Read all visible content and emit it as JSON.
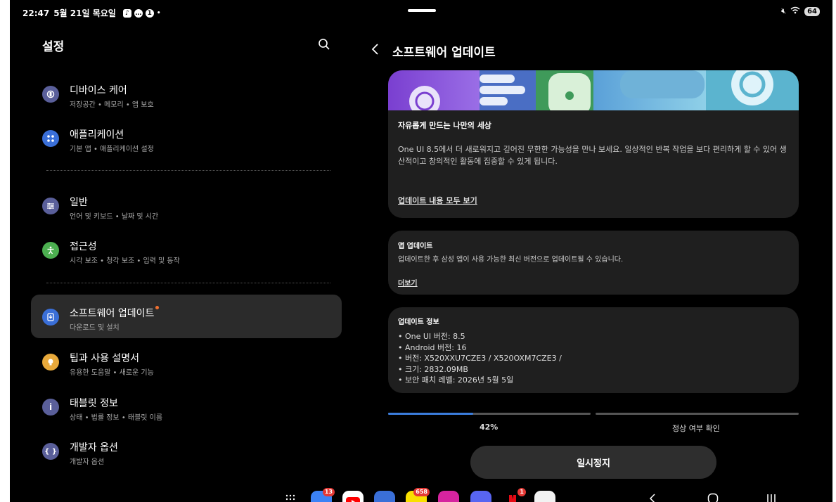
{
  "status_bar": {
    "time": "22:47",
    "date": "5월 21일 목요일",
    "notif_count": "1",
    "battery": "64"
  },
  "left": {
    "title": "설정",
    "items": [
      {
        "title": "디바이스 케어",
        "sub": "저장공간 • 메모리 • 앱 보호",
        "icon": "device-care-icon",
        "color": "#5a5f9a"
      },
      {
        "title": "애플리케이션",
        "sub": "기본 앱 • 애플리케이션 설정",
        "icon": "apps-icon",
        "color": "#3a6fd8"
      },
      {
        "title": "일반",
        "sub": "언어 및 키보드 • 날짜 및 시간",
        "icon": "general-icon",
        "color": "#5a5f9a"
      },
      {
        "title": "접근성",
        "sub": "시각 보조 • 청각 보조 • 입력 및 동작",
        "icon": "accessibility-icon",
        "color": "#4caf50"
      },
      {
        "title": "소프트웨어 업데이트",
        "sub": "다운로드 및 설치",
        "icon": "software-update-icon",
        "color": "#3a6fd8"
      },
      {
        "title": "팁과 사용 설명서",
        "sub": "유용한 도움말 • 새로운 기능",
        "icon": "tips-icon",
        "color": "#e8a93b"
      },
      {
        "title": "태블릿 정보",
        "sub": "상태 • 법률 정보 • 태블릿 이름",
        "icon": "info-icon",
        "color": "#5a5f9a"
      },
      {
        "title": "개발자 옵션",
        "sub": "개발자 옵션",
        "icon": "developer-icon",
        "color": "#5a5f9a"
      }
    ]
  },
  "right": {
    "title": "소프트웨어 업데이트",
    "card1": {
      "heading": "자유롭게 만드는 나만의 세상",
      "body": "One UI 8.5에서 더 새로워지고 깊어진 무한한 가능성을 만나 보세요. 일상적인 반복 작업을 보다 편리하게 할 수 있어 생산적이고 창의적인 활동에 집중할 수 있게 됩니다.",
      "link": "업데이트 내용 모두 보기"
    },
    "card2": {
      "heading": "앱 업데이트",
      "body": "업데이트한 후 삼성 앱이 사용 가능한 최신 버전으로 업데이트될 수 있습니다.",
      "link": "더보기"
    },
    "card3": {
      "heading": "업데이트 정보",
      "lines": [
        "• One UI 버전: 8.5",
        "• Android 버전: 16",
        "• 버전: X520XXU7CZE3 / X520OXM7CZE3 /",
        "• 크기: 2832.09MB",
        "• 보안 패치 레벨: 2026년 5월 5일"
      ]
    },
    "progress": {
      "percent_label": "42%",
      "value": 0.42,
      "step2_label": "정상 여부 확인"
    },
    "pause_button": "일시정지"
  },
  "taskbar": {
    "apps": [
      {
        "name": "messages-app",
        "color": "#3b82f6",
        "badge": "13"
      },
      {
        "name": "youtube-app",
        "color": "#ffffff",
        "badge": ""
      },
      {
        "name": "browser-app",
        "color": "#3a6fd8",
        "badge": ""
      },
      {
        "name": "kakaotalk-app",
        "color": "#f9e000",
        "badge": "658"
      },
      {
        "name": "instagram-app",
        "color": "#d6249f",
        "badge": ""
      },
      {
        "name": "discord-app",
        "color": "#5865f2",
        "badge": ""
      },
      {
        "name": "netflix-app",
        "color": "#000000",
        "badge": "1"
      },
      {
        "name": "laftel-app",
        "color": "#f2f2f2",
        "badge": ""
      }
    ]
  },
  "colors": {
    "accent": "#3b7ddd",
    "background": "#000000",
    "card": "#1f1f1f"
  }
}
